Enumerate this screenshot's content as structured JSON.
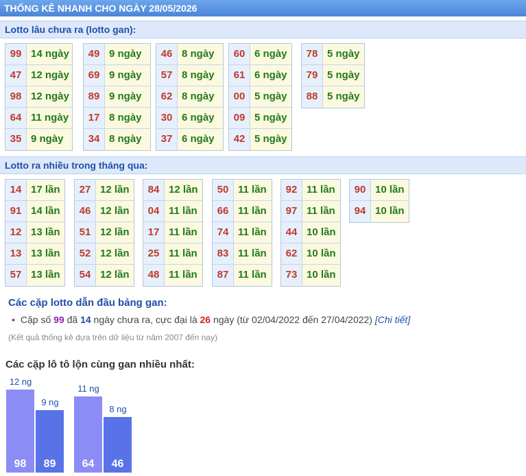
{
  "header": {
    "title": "THỐNG KÊ NHANH CHO NGÀY 28/05/2026"
  },
  "gan_section": {
    "title": "Lotto lâu chưa ra (lotto gan):",
    "columns": [
      [
        {
          "num": "99",
          "val": "14 ngày"
        },
        {
          "num": "47",
          "val": "12 ngày"
        },
        {
          "num": "98",
          "val": "12 ngày"
        },
        {
          "num": "64",
          "val": "11 ngày"
        },
        {
          "num": "35",
          "val": "9 ngày"
        }
      ],
      [
        {
          "num": "49",
          "val": "9 ngày"
        },
        {
          "num": "69",
          "val": "9 ngày"
        },
        {
          "num": "89",
          "val": "9 ngày"
        },
        {
          "num": "17",
          "val": "8 ngày"
        },
        {
          "num": "34",
          "val": "8 ngày"
        }
      ],
      [
        {
          "num": "46",
          "val": "8 ngày"
        },
        {
          "num": "57",
          "val": "8 ngày"
        },
        {
          "num": "62",
          "val": "8 ngày"
        },
        {
          "num": "30",
          "val": "6 ngày"
        },
        {
          "num": "37",
          "val": "6 ngày"
        }
      ],
      [
        {
          "num": "60",
          "val": "6 ngày"
        },
        {
          "num": "61",
          "val": "6 ngày"
        },
        {
          "num": "00",
          "val": "5 ngày"
        },
        {
          "num": "09",
          "val": "5 ngày"
        },
        {
          "num": "42",
          "val": "5 ngày"
        }
      ],
      [
        {
          "num": "78",
          "val": "5 ngày"
        },
        {
          "num": "79",
          "val": "5 ngày"
        },
        {
          "num": "88",
          "val": "5 ngày"
        }
      ]
    ]
  },
  "frequent_section": {
    "title": "Lotto ra nhiều trong tháng qua:",
    "columns": [
      [
        {
          "num": "14",
          "val": "17 lần"
        },
        {
          "num": "91",
          "val": "14 lần"
        },
        {
          "num": "12",
          "val": "13 lần"
        },
        {
          "num": "13",
          "val": "13 lần"
        },
        {
          "num": "57",
          "val": "13 lần"
        }
      ],
      [
        {
          "num": "27",
          "val": "12 lần"
        },
        {
          "num": "46",
          "val": "12 lần"
        },
        {
          "num": "51",
          "val": "12 lần"
        },
        {
          "num": "52",
          "val": "12 lần"
        },
        {
          "num": "54",
          "val": "12 lần"
        }
      ],
      [
        {
          "num": "84",
          "val": "12 lần"
        },
        {
          "num": "04",
          "val": "11 lần"
        },
        {
          "num": "17",
          "val": "11 lần"
        },
        {
          "num": "25",
          "val": "11 lần"
        },
        {
          "num": "48",
          "val": "11 lần"
        }
      ],
      [
        {
          "num": "50",
          "val": "11 lần"
        },
        {
          "num": "66",
          "val": "11 lần"
        },
        {
          "num": "74",
          "val": "11 lần"
        },
        {
          "num": "83",
          "val": "11 lần"
        },
        {
          "num": "87",
          "val": "11 lần"
        }
      ],
      [
        {
          "num": "92",
          "val": "11 lần"
        },
        {
          "num": "97",
          "val": "11 lần"
        },
        {
          "num": "44",
          "val": "10 lần"
        },
        {
          "num": "62",
          "val": "10 lần"
        },
        {
          "num": "73",
          "val": "10 lần"
        }
      ],
      [
        {
          "num": "90",
          "val": "10 lần"
        },
        {
          "num": "94",
          "val": "10 lần"
        }
      ]
    ]
  },
  "pairs": {
    "heading": "Các cặp lotto dẫn đầu bảng gan:",
    "bullet": "•",
    "text1": "Cặp số ",
    "pair": "99",
    "text2": " đã ",
    "days": "14",
    "text3": " ngày chưa ra, cực đại là ",
    "max": "26",
    "text4": " ngày (từ 02/04/2022 đến 27/04/2022) ",
    "link": "[Chi tiết]",
    "note": "(Kết quả thống kê dựa trên dữ liệu từ năm 2007 đến nay)"
  },
  "chart_heading": "Các cặp lô tô lộn cùng gan nhiều nhất:",
  "chart_data": {
    "type": "bar",
    "categories": [
      "98",
      "89",
      "64",
      "46"
    ],
    "values": [
      12,
      9,
      11,
      8
    ],
    "value_labels": [
      "12 ng",
      "9 ng",
      "11 ng",
      "8 ng"
    ],
    "colors": [
      "#8c8cf7",
      "#5a72e8",
      "#8c8cf7",
      "#5a72e8"
    ]
  }
}
